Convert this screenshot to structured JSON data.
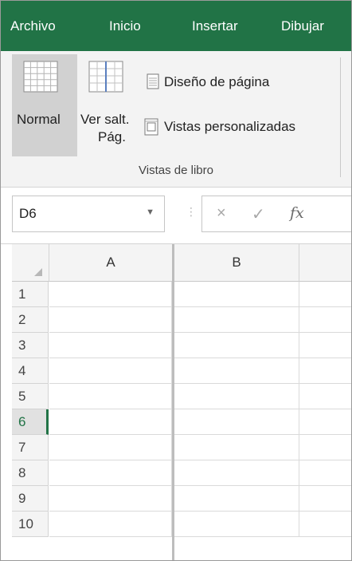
{
  "ribbon_tabs": [
    "Archivo",
    "Inicio",
    "Insertar",
    "Dibujar"
  ],
  "workbook_views": {
    "normal_label": "Normal",
    "page_break_label_line1": "Ver salt.",
    "page_break_label_line2": "Pág.",
    "page_layout_label": "Diseño de página",
    "custom_views_label": "Vistas personalizadas",
    "group_label": "Vistas de libro"
  },
  "formula_bar": {
    "name_box_value": "D6",
    "cancel_icon": "×",
    "enter_icon": "✓",
    "fx_label": "fx",
    "formula_value": ""
  },
  "sheet": {
    "columns": [
      "A",
      "B"
    ],
    "rows": [
      "1",
      "2",
      "3",
      "4",
      "5",
      "6",
      "7",
      "8",
      "9",
      "10"
    ],
    "active_row": "6"
  },
  "colors": {
    "accent": "#217346",
    "ribbon_bg": "#f3f3f3",
    "selected_button_bg": "#d1d1d1"
  }
}
